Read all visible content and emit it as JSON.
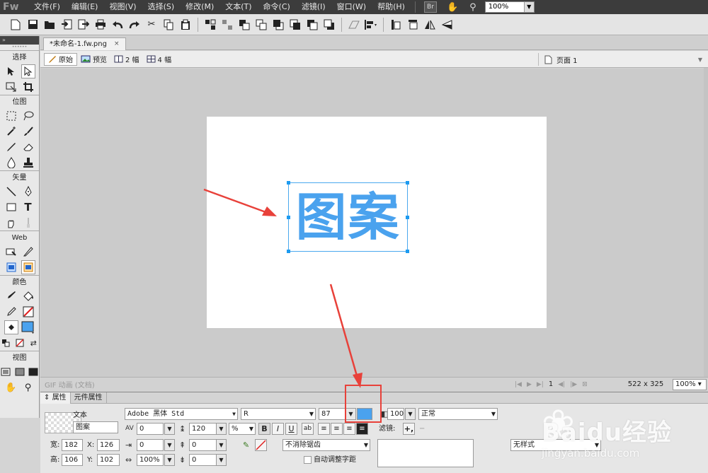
{
  "menubar": {
    "logo": "Fw",
    "items": [
      "文件(F)",
      "编辑(E)",
      "视图(V)",
      "选择(S)",
      "修改(M)",
      "文本(T)",
      "命令(C)",
      "滤镜(I)",
      "窗口(W)",
      "帮助(H)"
    ],
    "bridge_label": "Br",
    "zoom_value": "100%"
  },
  "document": {
    "tab_title": "*未命名-1.fw.png",
    "close_glyph": "×"
  },
  "viewbar": {
    "views": [
      "原始",
      "预览",
      "2 幅",
      "4 幅"
    ],
    "page_label": "页面 1"
  },
  "tools": {
    "sections": [
      "选择",
      "位图",
      "矢量",
      "Web",
      "颜色",
      "视图"
    ]
  },
  "canvas": {
    "text_content": "图案",
    "text_color": "#4aa2ee",
    "selection_color": "#1e9bf0"
  },
  "statusbar": {
    "left_text": "GIF 动画 (文档)",
    "frame": "1",
    "doc_size": "522 x 325",
    "zoom": "100%"
  },
  "properties": {
    "tabs": [
      "属性",
      "元件属性"
    ],
    "object_type": "文本",
    "object_name": "图案",
    "font_family": "Adobe 黑体 Std",
    "font_style": "R",
    "font_size": "87",
    "fill_color": "#4aa2ee",
    "opacity": "100",
    "blend_mode": "正常",
    "kerning": "0",
    "leading": "120",
    "leading_unit": "%",
    "bold": "B",
    "italic": "I",
    "underline": "U",
    "filters_label": "滤镜:",
    "filters_add": "+,",
    "filters_minus": "−",
    "indent": "0",
    "space_before": "0",
    "horizontal_scale": "100%",
    "space_after": "0",
    "antialias": "不消除锯齿",
    "auto_kern_label": "自动调整字距",
    "width_label": "宽:",
    "width": "182",
    "height_label": "高:",
    "height": "106",
    "x_label": "X:",
    "x": "126",
    "y_label": "Y:",
    "y": "102",
    "style": "无样式"
  },
  "watermark": {
    "brand": "Baidu经验",
    "url": "jingyan.baidu.com"
  },
  "annotations": {
    "color": "#e8413a"
  }
}
